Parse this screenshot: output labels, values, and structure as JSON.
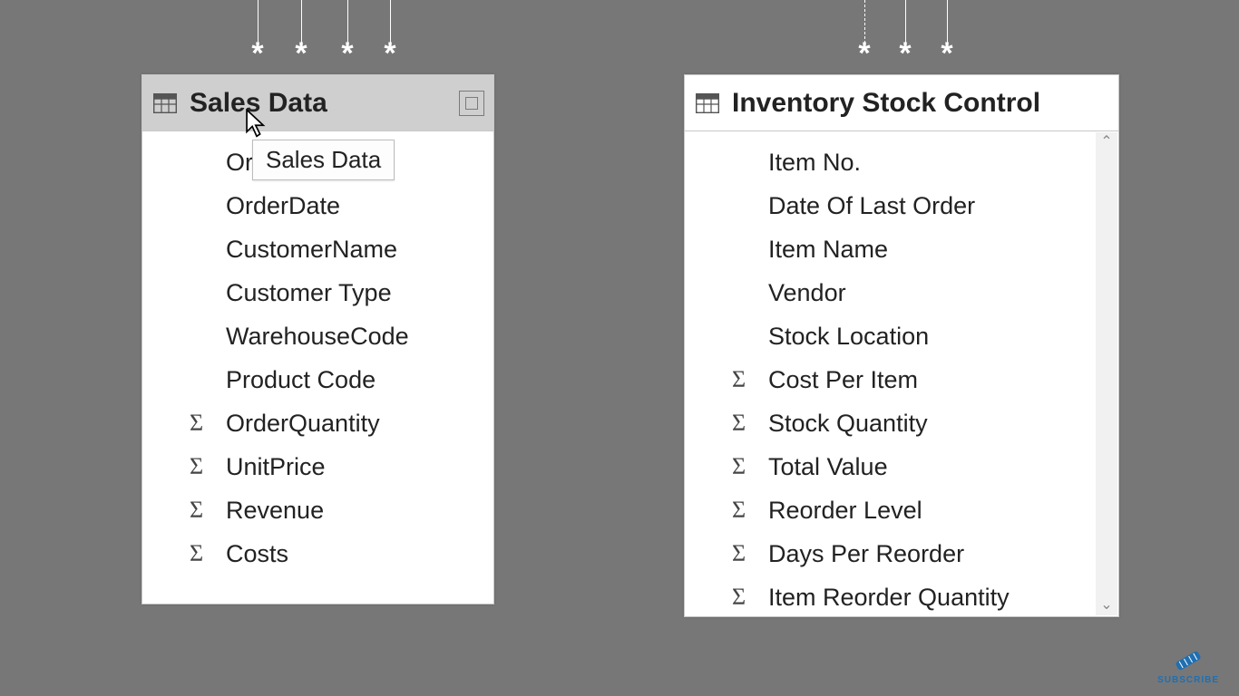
{
  "tables": {
    "sales": {
      "title": "Sales Data",
      "selected": true,
      "fields": [
        {
          "label": "OrderID",
          "numeric": false
        },
        {
          "label": "OrderDate",
          "numeric": false
        },
        {
          "label": "CustomerName",
          "numeric": false
        },
        {
          "label": "Customer Type",
          "numeric": false
        },
        {
          "label": "WarehouseCode",
          "numeric": false
        },
        {
          "label": "Product Code",
          "numeric": false
        },
        {
          "label": "OrderQuantity",
          "numeric": true
        },
        {
          "label": "UnitPrice",
          "numeric": true
        },
        {
          "label": "Revenue",
          "numeric": true
        },
        {
          "label": "Costs",
          "numeric": true
        }
      ]
    },
    "inventory": {
      "title": "Inventory Stock Control",
      "selected": false,
      "fields": [
        {
          "label": "Item No.",
          "numeric": false
        },
        {
          "label": "Date Of Last Order",
          "numeric": false
        },
        {
          "label": "Item Name",
          "numeric": false
        },
        {
          "label": "Vendor",
          "numeric": false
        },
        {
          "label": "Stock Location",
          "numeric": false
        },
        {
          "label": "Cost Per Item",
          "numeric": true
        },
        {
          "label": "Stock Quantity",
          "numeric": true
        },
        {
          "label": "Total Value",
          "numeric": true
        },
        {
          "label": "Reorder Level",
          "numeric": true
        },
        {
          "label": "Days Per Reorder",
          "numeric": true
        },
        {
          "label": "Item Reorder Quantity",
          "numeric": true
        }
      ]
    }
  },
  "tooltip": {
    "text": "Sales Data"
  },
  "rel_asterisks": {
    "sales": {
      "xs": [
        284,
        332,
        383,
        430
      ],
      "dashed_index": -1
    },
    "inventory": {
      "xs": [
        953,
        998,
        1044
      ],
      "dashed_index": 0
    }
  },
  "watermark": {
    "label": "SUBSCRIBE"
  }
}
